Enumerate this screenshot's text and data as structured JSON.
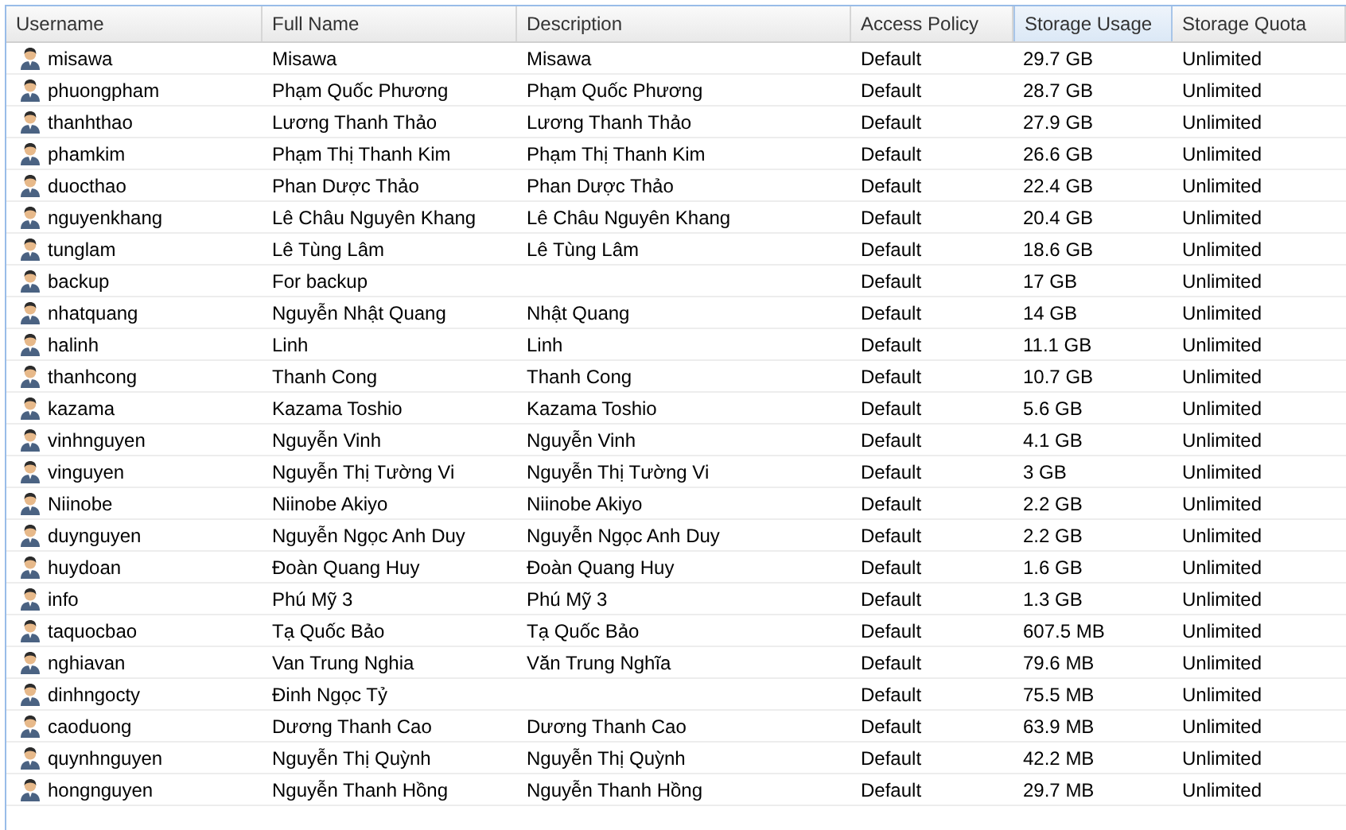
{
  "table": {
    "columns": [
      {
        "label": "Username",
        "sorted": false
      },
      {
        "label": "Full Name",
        "sorted": false
      },
      {
        "label": "Description",
        "sorted": false
      },
      {
        "label": "Access Policy",
        "sorted": false
      },
      {
        "label": "Storage Usage",
        "sorted": true
      },
      {
        "label": "Storage Quota",
        "sorted": false
      }
    ],
    "rows": [
      {
        "username": "misawa",
        "full_name": "Misawa",
        "description": "Misawa",
        "access_policy": "Default",
        "storage_usage": "29.7 GB",
        "storage_quota": "Unlimited"
      },
      {
        "username": "phuongpham",
        "full_name": "Phạm Quốc Phương",
        "description": "Phạm Quốc Phương",
        "access_policy": "Default",
        "storage_usage": "28.7 GB",
        "storage_quota": "Unlimited"
      },
      {
        "username": "thanhthao",
        "full_name": "Lương Thanh Thảo",
        "description": "Lương Thanh Thảo",
        "access_policy": "Default",
        "storage_usage": "27.9 GB",
        "storage_quota": "Unlimited"
      },
      {
        "username": "phamkim",
        "full_name": "Phạm Thị Thanh Kim",
        "description": "Phạm Thị Thanh Kim",
        "access_policy": "Default",
        "storage_usage": "26.6 GB",
        "storage_quota": "Unlimited"
      },
      {
        "username": "duocthao",
        "full_name": "Phan Dược Thảo",
        "description": "Phan Dược Thảo",
        "access_policy": "Default",
        "storage_usage": "22.4 GB",
        "storage_quota": "Unlimited"
      },
      {
        "username": "nguyenkhang",
        "full_name": "Lê Châu Nguyên Khang",
        "description": "Lê Châu Nguyên Khang",
        "access_policy": "Default",
        "storage_usage": "20.4 GB",
        "storage_quota": "Unlimited"
      },
      {
        "username": "tunglam",
        "full_name": "Lê Tùng Lâm",
        "description": "Lê Tùng Lâm",
        "access_policy": "Default",
        "storage_usage": "18.6 GB",
        "storage_quota": "Unlimited"
      },
      {
        "username": "backup",
        "full_name": "For backup",
        "access_policy": "Default",
        "storage_usage": "17 GB",
        "storage_quota": "Unlimited"
      },
      {
        "username": "nhatquang",
        "full_name": "Nguyễn Nhật Quang",
        "description": "Nhật Quang",
        "access_policy": "Default",
        "storage_usage": "14 GB",
        "storage_quota": "Unlimited"
      },
      {
        "username": "halinh",
        "full_name": "Linh",
        "description": "Linh",
        "access_policy": "Default",
        "storage_usage": "11.1 GB",
        "storage_quota": "Unlimited"
      },
      {
        "username": "thanhcong",
        "full_name": "Thanh Cong",
        "description": "Thanh Cong",
        "access_policy": "Default",
        "storage_usage": "10.7 GB",
        "storage_quota": "Unlimited"
      },
      {
        "username": "kazama",
        "full_name": "Kazama Toshio",
        "description": "Kazama Toshio",
        "access_policy": "Default",
        "storage_usage": "5.6 GB",
        "storage_quota": "Unlimited"
      },
      {
        "username": "vinhnguyen",
        "full_name": "Nguyễn Vinh",
        "description": "Nguyễn Vinh",
        "access_policy": "Default",
        "storage_usage": "4.1 GB",
        "storage_quota": "Unlimited"
      },
      {
        "username": "vinguyen",
        "full_name": "Nguyễn Thị Tường Vi",
        "description": "Nguyễn Thị Tường Vi",
        "access_policy": "Default",
        "storage_usage": "3 GB",
        "storage_quota": "Unlimited"
      },
      {
        "username": "Niinobe",
        "full_name": "Niinobe Akiyo",
        "description": "Niinobe Akiyo",
        "access_policy": "Default",
        "storage_usage": "2.2 GB",
        "storage_quota": "Unlimited"
      },
      {
        "username": "duynguyen",
        "full_name": "Nguyễn Ngọc Anh Duy",
        "description": "Nguyễn Ngọc Anh Duy",
        "access_policy": "Default",
        "storage_usage": "2.2 GB",
        "storage_quota": "Unlimited"
      },
      {
        "username": "huydoan",
        "full_name": "Đoàn Quang Huy",
        "description": "Đoàn Quang Huy",
        "access_policy": "Default",
        "storage_usage": "1.6 GB",
        "storage_quota": "Unlimited"
      },
      {
        "username": "info",
        "full_name": "Phú Mỹ 3",
        "description": "Phú Mỹ 3",
        "access_policy": "Default",
        "storage_usage": "1.3 GB",
        "storage_quota": "Unlimited"
      },
      {
        "username": "taquocbao",
        "full_name": "Tạ Quốc Bảo",
        "description": "Tạ Quốc Bảo",
        "access_policy": "Default",
        "storage_usage": "607.5 MB",
        "storage_quota": "Unlimited"
      },
      {
        "username": "nghiavan",
        "full_name": "Van Trung Nghia",
        "description": "Văn Trung Nghĩa",
        "access_policy": "Default",
        "storage_usage": "79.6 MB",
        "storage_quota": "Unlimited"
      },
      {
        "username": "dinhngocty",
        "full_name": "Đinh Ngọc Tỷ",
        "access_policy": "Default",
        "storage_usage": "75.5 MB",
        "storage_quota": "Unlimited"
      },
      {
        "username": "caoduong",
        "full_name": "Dương Thanh Cao",
        "description": "Dương Thanh Cao",
        "access_policy": "Default",
        "storage_usage": "63.9 MB",
        "storage_quota": "Unlimited"
      },
      {
        "username": "quynhnguyen",
        "full_name": "Nguyễn Thị Quỳnh",
        "description": "Nguyễn Thị Quỳnh",
        "access_policy": "Default",
        "storage_usage": "42.2 MB",
        "storage_quota": "Unlimited"
      },
      {
        "username": "hongnguyen",
        "full_name": "Nguyễn Thanh Hồng",
        "description": "Nguyễn Thanh Hồng",
        "access_policy": "Default",
        "storage_usage": "29.7 MB",
        "storage_quota": "Unlimited"
      }
    ]
  }
}
